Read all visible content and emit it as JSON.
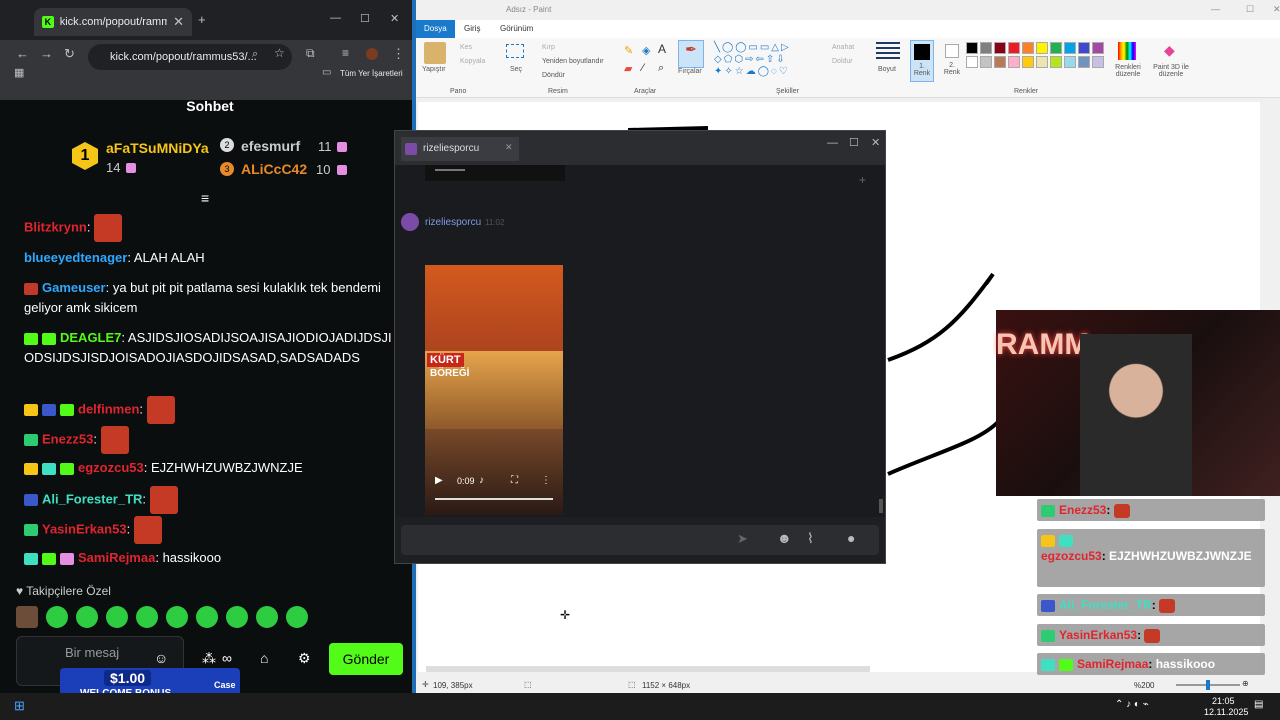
{
  "browser": {
    "tab_title": "kick.com/popout/rammus53/c",
    "url": "kick.com/popout/rammus53/...",
    "bookmarks_label": "Tüm Yer İşaretleri",
    "chat_title": "Sohbet",
    "leaderboard": [
      {
        "rank": "1",
        "name": "aFaTSuMNiDYa",
        "count": "14"
      },
      {
        "rank": "2",
        "name": "efesmurf",
        "count": "11"
      },
      {
        "rank": "3",
        "name": "ALiCcC42",
        "count": "10"
      }
    ],
    "messages": [
      {
        "user": "Blitzkrynn",
        "text": ""
      },
      {
        "user": "blueeyedtenager",
        "text": "ALAH ALAH"
      },
      {
        "user": "Gameuser",
        "text": "ya but pit pit patlama sesi kulaklık tek bendemi geliyor amk sikicem"
      },
      {
        "user": "DEAGLE7",
        "text": "ASJIDSJIOSADIJSOAJISAJIODIOJADIJDSJIODSIJDSJISDJOISADOJIASDOJIDSASAD,SADSADADS"
      },
      {
        "user": "delfinmen",
        "text": ""
      },
      {
        "user": "Enezz53",
        "text": ""
      },
      {
        "user": "egzozcu53",
        "text": "EJZHWHZUWBZJWNZJE"
      },
      {
        "user": "Ali_Forester_TR",
        "text": ""
      },
      {
        "user": "YasinErkan53",
        "text": ""
      },
      {
        "user": "SamiRejmaa",
        "text": "hassikooo"
      }
    ],
    "followers_only": "Takipçilere Özel",
    "input_placeholder": "Bir mesaj",
    "send_label": "Gönder"
  },
  "paint": {
    "title": "Adsız - Paint",
    "tabs": [
      "Dosya",
      "Giriş",
      "Görünüm"
    ],
    "groups": {
      "pano": "Pano",
      "resim": "Resim",
      "araclar": "Araçlar",
      "sekiller": "Şekiller",
      "renkler": "Renkler"
    },
    "paste": "Yapıştır",
    "cut": "Kes",
    "copy": "Kopyala",
    "select": "Seç",
    "crop": "Kırp",
    "resize": "Yeniden boyutlandır",
    "rotate": "Döndür",
    "brushes": "Fırçalar",
    "outline": "Anahat",
    "fill": "Doldur",
    "size": "Boyut",
    "color1": "1. Renk",
    "color2": "2. Renk",
    "edit_colors": "Renkleri düzenle",
    "paint3d": "Paint 3D ile düzenle",
    "cursor_pos": "109, 385px",
    "canvas_size": "1152 × 648px",
    "zoom": "%200",
    "palette": [
      "#000000",
      "#7f7f7f",
      "#880015",
      "#ed1c24",
      "#ff7f27",
      "#fff200",
      "#22b14c",
      "#00a2e8",
      "#3f48cc",
      "#a349a4",
      "#ffffff",
      "#c3c3c3",
      "#b97a57",
      "#ffaec9",
      "#ffc90e",
      "#efe4b0",
      "#b5e61d",
      "#99d9ea",
      "#7092be",
      "#c8bfe7"
    ]
  },
  "discord": {
    "user": "rizeliesporcu",
    "time": "11:02",
    "video_text1": "KÜRT",
    "video_text2": "BÖREĞİ",
    "video_time": "0:09"
  },
  "overlay": [
    {
      "user": "Enezz53",
      "text": ""
    },
    {
      "user": "egzozcu53",
      "text": "EJZHWHZUWBZJWNZJE"
    },
    {
      "user": "Ali_Forester_TR",
      "text": ""
    },
    {
      "user": "YasinErkan53",
      "text": ""
    },
    {
      "user": "SamiRejmaa",
      "text": "hassikooo"
    }
  ],
  "webcam_banner": "RAMM",
  "promo": {
    "amount": "$1.00",
    "label": "WELCOME BONUS",
    "brand": "Case"
  },
  "taskbar": {
    "time": "21:05",
    "date": "12.11.2025"
  }
}
